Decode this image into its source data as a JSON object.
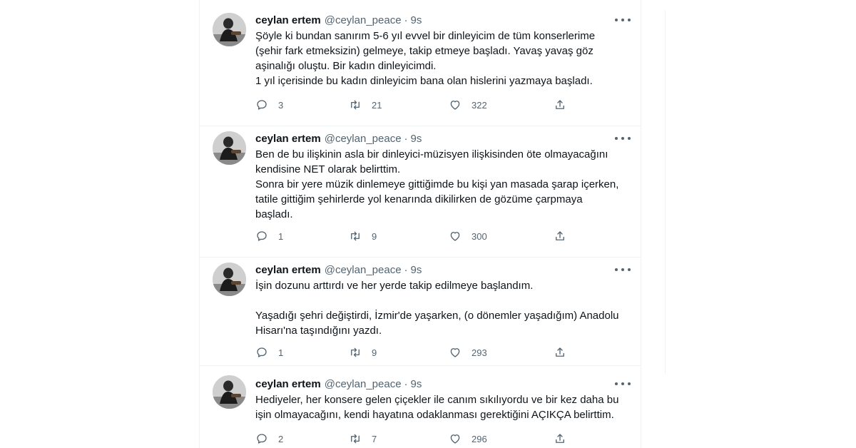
{
  "tweets": [
    {
      "author": "ceylan ertem",
      "handle": "@ceylan_peace",
      "sep": "·",
      "time": "9s",
      "lines": [
        "Şöyle ki bundan sanırım 5-6 yıl evvel bir dinleyicim de tüm konserlerime",
        "(şehir fark etmeksizin) gelmeye, takip etmeye başladı. Yavaş yavaş göz",
        "aşinalığı oluştu. Bir kadın dinleyicimdi.",
        "1 yıl içerisinde bu kadın dinleyicim bana olan hislerini yazmaya başladı."
      ],
      "replies": "3",
      "retweets": "21",
      "likes": "322"
    },
    {
      "author": "ceylan ertem",
      "handle": "@ceylan_peace",
      "sep": "·",
      "time": "9s",
      "lines": [
        "Ben de bu ilişkinin asla bir dinleyici-müzisyen ilişkisinden öte olmayacağını",
        "kendisine NET olarak belirttim.",
        "Sonra bir yere müzik dinlemeye gittiğimde bu kişi yan masada şarap içerken,",
        "tatile gittiğim şehirlerde yol kenarında dikilirken de gözüme çarpmaya",
        "başladı."
      ],
      "replies": "1",
      "retweets": "9",
      "likes": "300"
    },
    {
      "author": "ceylan ertem",
      "handle": "@ceylan_peace",
      "sep": "·",
      "time": "9s",
      "lines": [
        "İşin dozunu arttırdı ve her yerde takip edilmeye başlandım.",
        "Yaşadığı şehri değiştirdi, İzmir'de yaşarken, (o dönemler yaşadığım) Anadolu",
        "Hisarı'na taşındığını yazdı."
      ],
      "replies": "1",
      "retweets": "9",
      "likes": "293"
    },
    {
      "author": "ceylan ertem",
      "handle": "@ceylan_peace",
      "sep": "·",
      "time": "9s",
      "lines": [
        "Hediyeler, her konsere gelen çiçekler ile canım sıkılıyordu ve bir kez daha bu",
        "işin olmayacağını, kendi hayatına odaklanması gerektiğini AÇIKÇA belirttim."
      ],
      "replies": "2",
      "retweets": "7",
      "likes": "296"
    }
  ]
}
